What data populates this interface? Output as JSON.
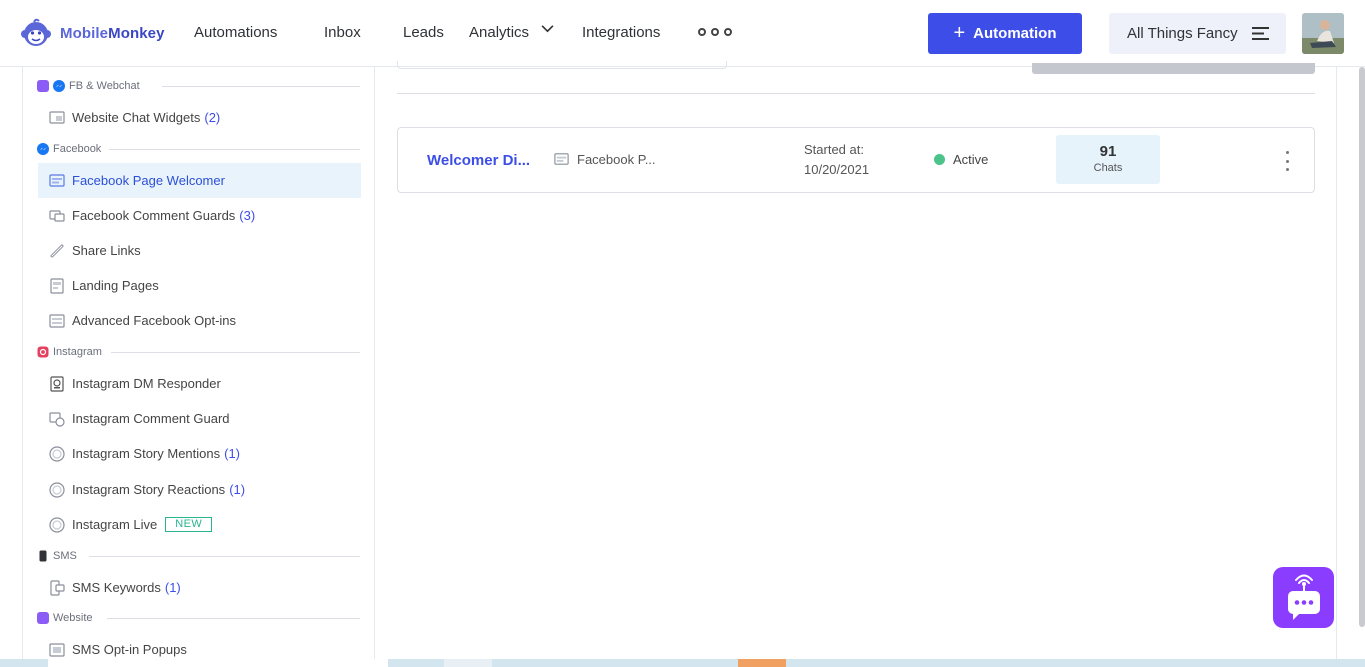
{
  "header": {
    "logo_text_1": "Mobile",
    "logo_text_2": "Monkey",
    "nav": {
      "automations": "Automations",
      "inbox": "Inbox",
      "leads": "Leads",
      "analytics": "Analytics",
      "integrations": "Integrations"
    },
    "new_automation_button": "Automation",
    "workspace_name": "All Things Fancy"
  },
  "sidebar": {
    "sections": {
      "fb_webchat": "FB & Webchat",
      "facebook": "Facebook",
      "instagram": "Instagram",
      "sms": "SMS",
      "website": "Website"
    },
    "items": [
      {
        "label": "Website Chat Widgets",
        "count": "(2)"
      },
      {
        "label": "Facebook Page Welcomer",
        "count": ""
      },
      {
        "label": "Facebook Comment Guards",
        "count": "(3)"
      },
      {
        "label": "Share Links",
        "count": ""
      },
      {
        "label": "Landing Pages",
        "count": ""
      },
      {
        "label": "Advanced Facebook Opt-ins",
        "count": ""
      },
      {
        "label": "Instagram DM Responder",
        "count": ""
      },
      {
        "label": "Instagram Comment Guard",
        "count": ""
      },
      {
        "label": "Instagram Story Mentions",
        "count": "(1)"
      },
      {
        "label": "Instagram Story Reactions",
        "count": "(1)"
      },
      {
        "label": "Instagram Live",
        "count": "",
        "badge": "NEW"
      },
      {
        "label": "SMS Keywords",
        "count": "(1)"
      },
      {
        "label": "SMS Opt-in Popups",
        "count": ""
      }
    ],
    "active_item": "Facebook Page Welcomer"
  },
  "main": {
    "automation_card": {
      "title": "Welcomer Di...",
      "type": "Facebook P...",
      "started_label": "Started at:",
      "started_date": "10/20/2021",
      "status": "Active",
      "chats_count": "91",
      "chats_label": "Chats"
    }
  },
  "colors": {
    "brand_blue": "#3d4ee8",
    "active_item_bg": "#e8f3fb",
    "status_active": "#4cc38a",
    "chat_launcher": "#8b3dff",
    "new_badge": "#2bb38f"
  },
  "icons": {
    "logo": "monkey-logo-icon",
    "analytics_dropdown": "chevron-down-icon",
    "more": "more-dots-icon",
    "plus": "plus-icon",
    "workspace_menu": "menu-lines-icon",
    "row_menu": "kebab-menu-icon",
    "chat_launcher": "chat-broadcast-icon"
  }
}
